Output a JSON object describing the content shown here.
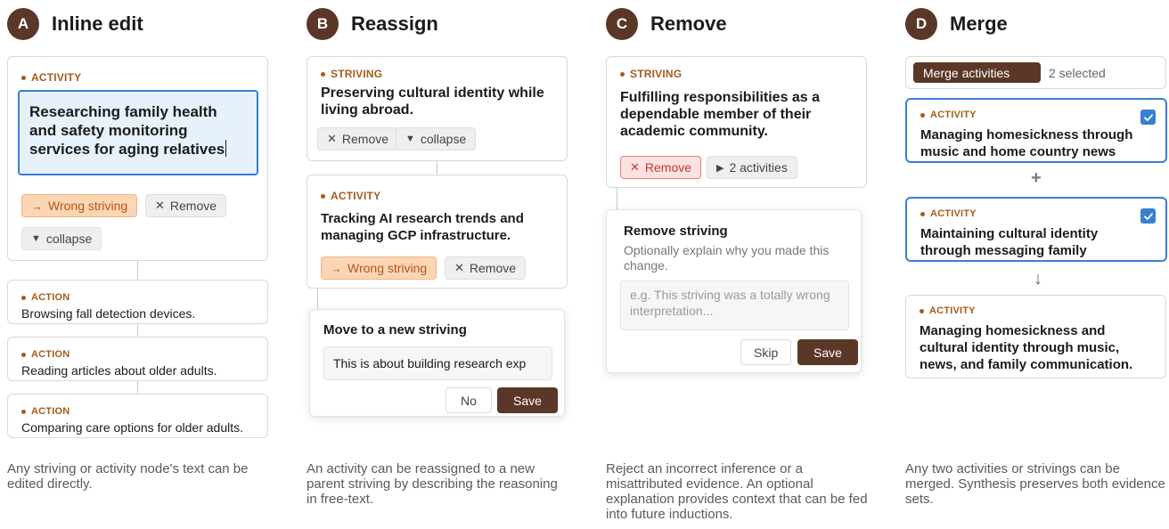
{
  "panels": {
    "a": {
      "badge": "A",
      "title": "Inline edit",
      "activity_label": "ACTIVITY",
      "activity_text": "Researching family health and safety monitoring services for aging relatives",
      "wrong_striving_label": "Wrong striving",
      "remove_label": "Remove",
      "collapse_label": "collapse",
      "actions": [
        {
          "label": "ACTION",
          "text": "Browsing fall detection devices."
        },
        {
          "label": "ACTION",
          "text": "Reading articles about older adults."
        },
        {
          "label": "ACTION",
          "text": "Comparing care options for older adults."
        }
      ],
      "caption": "Any striving or activity node's text can be edited directly."
    },
    "b": {
      "badge": "B",
      "title": "Reassign",
      "striving_label": "STRIVING",
      "striving_text": "Preserving cultural identity while living abroad.",
      "remove_label": "Remove",
      "collapse_label": "collapse",
      "activity_label": "ACTIVITY",
      "activity_text": "Tracking AI research trends and managing GCP infrastructure.",
      "wrong_striving_label": "Wrong striving",
      "remove2_label": "Remove",
      "popup_title": "Move to a new striving",
      "popup_input_value": "This is about building research exp",
      "no_label": "No",
      "save_label": "Save",
      "caption": "An activity can be reassigned to a new parent striving by describing the reasoning in free-text."
    },
    "c": {
      "badge": "C",
      "title": "Remove",
      "striving_label": "STRIVING",
      "striving_text": "Fulfilling responsibilities as a dependable member of their academic community.",
      "remove_label": "Remove",
      "activities_label": "2 activities",
      "popup_title": "Remove striving",
      "popup_desc": "Optionally explain why you made this change.",
      "popup_placeholder": "e.g. This striving was a totally wrong interpretation...",
      "skip_label": "Skip",
      "save_label": "Save",
      "caption": "Reject an incorrect inference or a misattributed evidence. An optional explanation provides context that can be fed into future inductions."
    },
    "d": {
      "badge": "D",
      "title": "Merge",
      "merge_button_label": "Merge activities",
      "selected_count": "2 selected",
      "activity1_label": "ACTIVITY",
      "activity1_text": "Managing homesickness through music and home country news",
      "plus_symbol": "+",
      "activity2_label": "ACTIVITY",
      "activity2_text": "Maintaining cultural identity through messaging family",
      "arrow_symbol": "↓",
      "merged_label": "ACTIVITY",
      "merged_text": "Managing homesickness and cultural identity through music, news, and family communication.",
      "caption": "Any two activities or strivings can be merged. Synthesis preserves both evidence sets."
    }
  },
  "icons": {
    "arrow_right": "→",
    "close": "✕",
    "collapse": "▼",
    "expand": "▶"
  },
  "colors": {
    "brand_dark": "#5a3727",
    "label_orange": "#a65b1a",
    "selection_blue": "#3a7fd0",
    "warning_orange_bg": "#fcd6b4",
    "danger_red": "#c43a2f"
  }
}
